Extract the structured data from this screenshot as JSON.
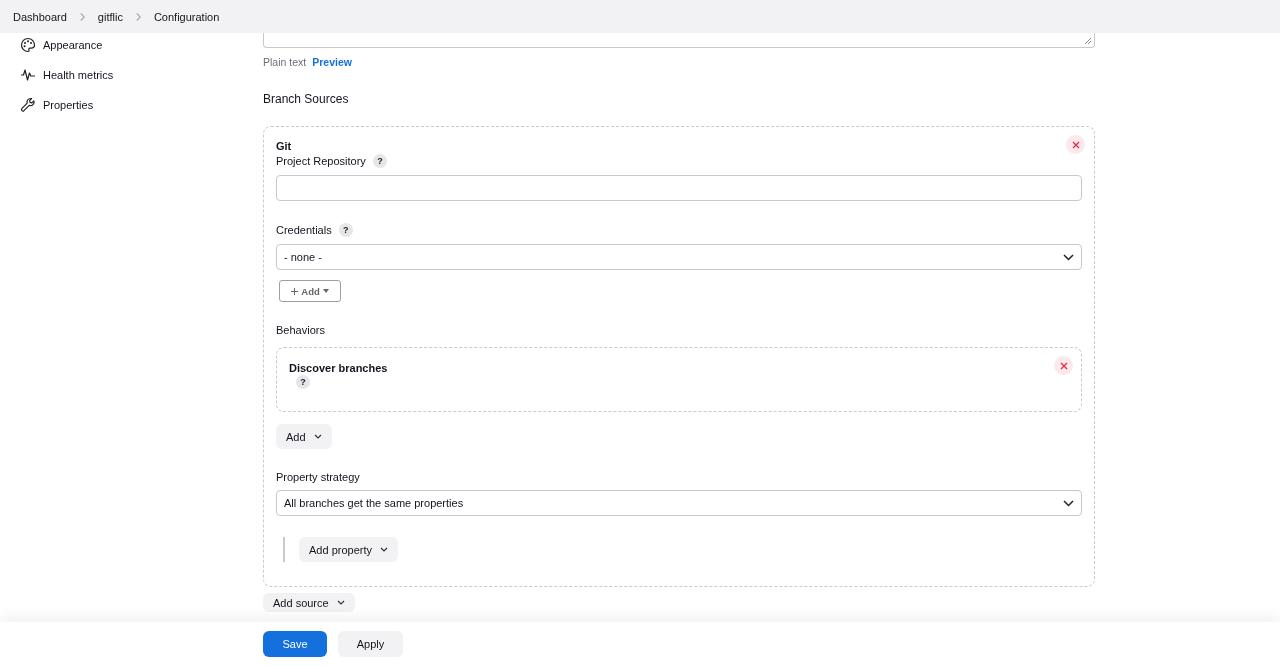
{
  "breadcrumbs": [
    "Dashboard",
    "gitflic",
    "Configuration"
  ],
  "sidebar": {
    "items": [
      {
        "label": "Appearance"
      },
      {
        "label": "Health metrics"
      },
      {
        "label": "Properties"
      }
    ]
  },
  "description": {
    "format_tabs": [
      {
        "label": "Plain text",
        "kind": "plain"
      },
      {
        "label": "Preview",
        "kind": "link"
      }
    ]
  },
  "branch_sources": {
    "title": "Branch Sources",
    "source": {
      "type": "Git",
      "repository_label": "Project Repository",
      "credentials_label": "Credentials",
      "credentials_value": "- none -",
      "add_credentials": "Add",
      "behaviors_label": "Behaviors",
      "behaviors": [
        {
          "name": "Discover branches"
        }
      ],
      "add_behavior": "Add",
      "property_strategy_label": "Property strategy",
      "property_strategy_value": "All branches get the same properties",
      "add_property": "Add property"
    },
    "help_mark": "?",
    "add_source": "Add source"
  },
  "buttons": [
    {
      "label": "Save",
      "kind": "primary"
    },
    {
      "label": "Apply",
      "kind": "secondary"
    }
  ]
}
